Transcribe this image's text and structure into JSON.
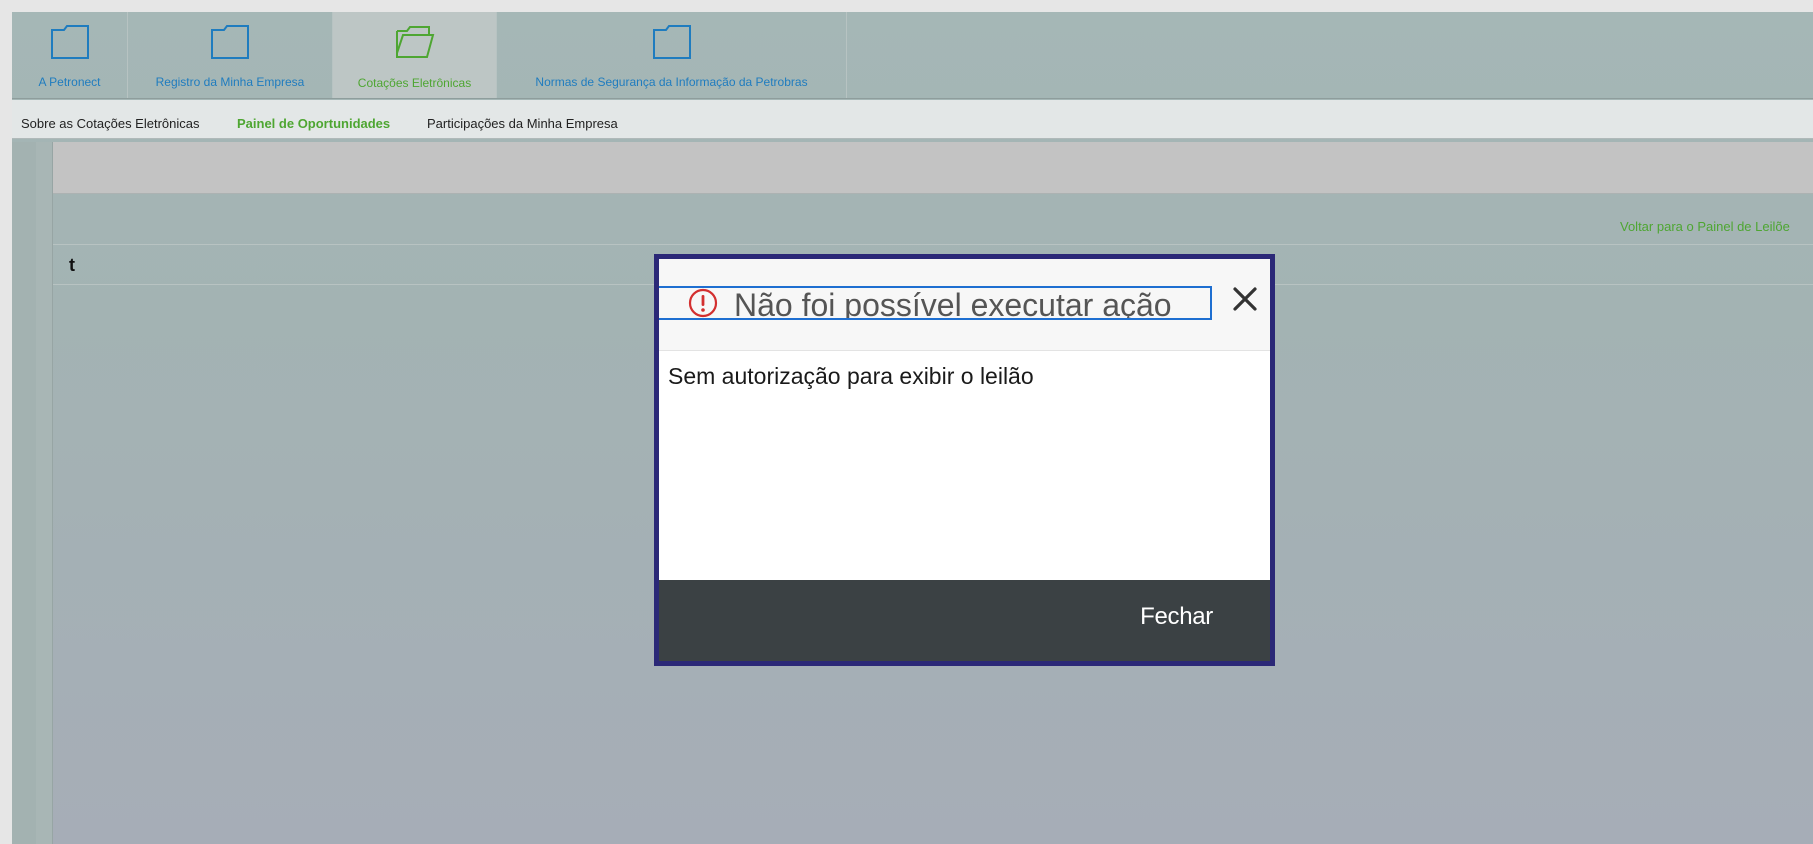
{
  "tabs": [
    {
      "label": "A Petronect",
      "icon": "folder-icon"
    },
    {
      "label": "Registro da Minha Empresa",
      "icon": "folder-icon"
    },
    {
      "label": "Cotações Eletrônicas",
      "icon": "folder-open-icon",
      "active": true
    },
    {
      "label": "Normas de Segurança da Informação da Petrobras",
      "icon": "folder-icon"
    }
  ],
  "subnav": [
    {
      "label": "Sobre as Cotações Eletrônicas"
    },
    {
      "label": "Painel de Oportunidades",
      "active": true
    },
    {
      "label": "Participações da Minha Empresa"
    }
  ],
  "content": {
    "back_link": "Voltar para o Painel de Leilõe",
    "row_text": "t"
  },
  "modal": {
    "title": "Não foi possível executar ação",
    "message": "Sem autorização para exibir o leilão",
    "close_label": "Fechar"
  },
  "colors": {
    "tab_link": "#1f7cbf",
    "active_green": "#4ea632",
    "modal_border": "#2b2877",
    "modal_footer": "#3b4144",
    "warning_red": "#d32f2f"
  }
}
